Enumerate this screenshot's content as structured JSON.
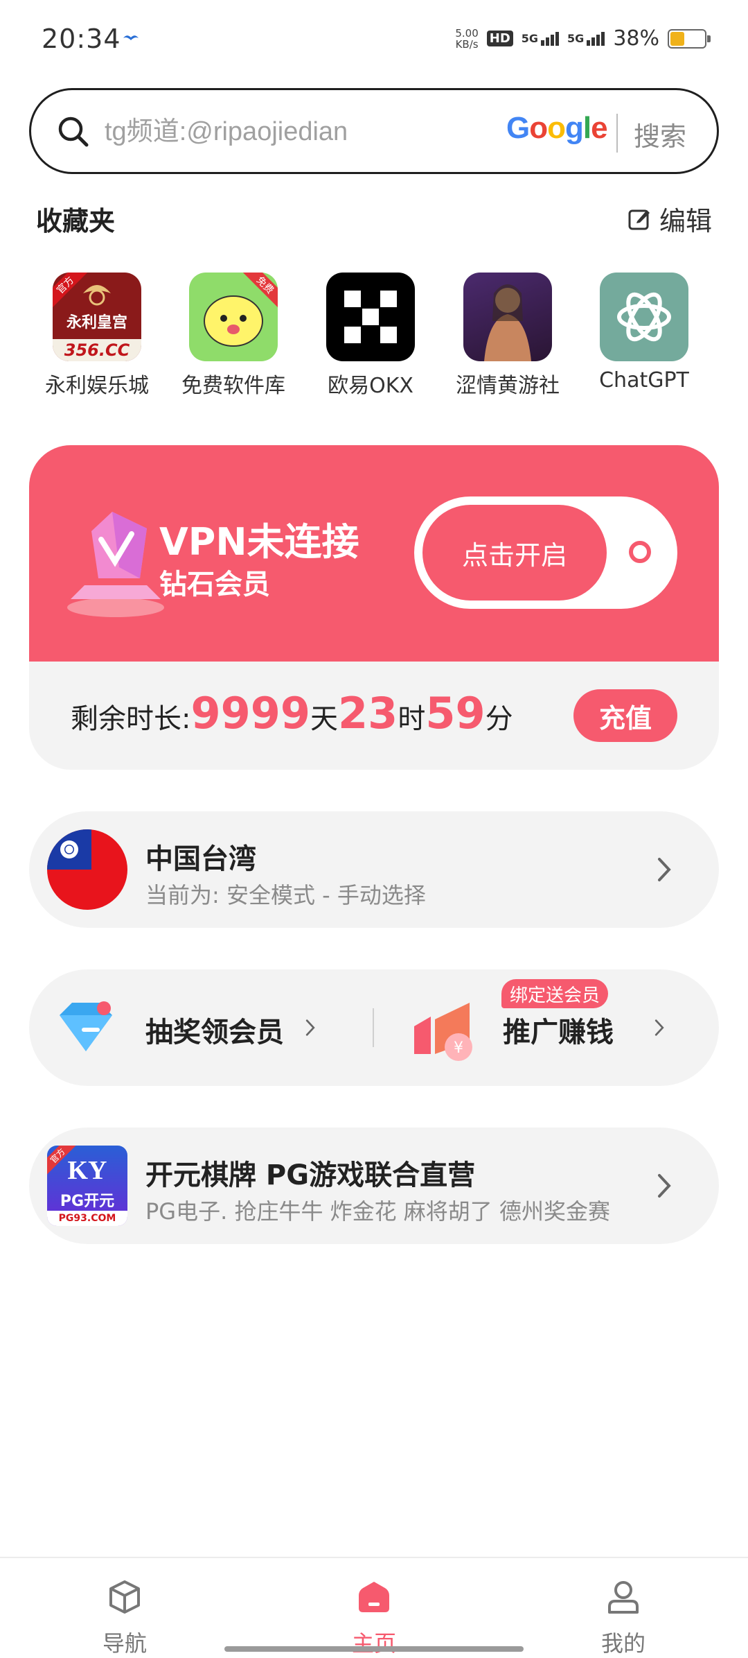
{
  "status_bar": {
    "time": "20:34",
    "net_speed_value": "5.00",
    "net_speed_unit": "KB/s",
    "hd": "HD",
    "signal1": "5G",
    "signal2": "5G",
    "battery": "38%"
  },
  "search": {
    "placeholder": "tg频道:@ripaojiedian",
    "engine": "Google",
    "button": "搜索"
  },
  "favorites": {
    "title": "收藏夹",
    "edit": "编辑",
    "apps": [
      {
        "label": "永利娱乐城",
        "icon": "yongli-casino-icon",
        "icon_text_top": "永利皇宫",
        "icon_text_bottom": "356.CC",
        "badge": "官方"
      },
      {
        "label": "免费软件库",
        "icon": "free-software-icon",
        "badge": "免费"
      },
      {
        "label": "欧易OKX",
        "icon": "okx-icon"
      },
      {
        "label": "涩情黄游社",
        "icon": "game-club-icon"
      },
      {
        "label": "ChatGPT",
        "icon": "chatgpt-icon"
      }
    ]
  },
  "vpn": {
    "status": "VPN未连接",
    "level": "钻石会员",
    "connect_button": "点击开启",
    "remaining_label": "剩余时长:",
    "days": "9999",
    "days_unit": "天",
    "hours": "23",
    "hours_unit": "时",
    "minutes": "59",
    "minutes_unit": "分",
    "recharge": "充值",
    "accent": "#f65a6e"
  },
  "server": {
    "name": "中国台湾",
    "mode": "当前为: 安全模式 - 手动选择"
  },
  "promo": {
    "lottery": "抽奖领会员",
    "promote": "推广赚钱",
    "badge": "绑定送会员"
  },
  "ad": {
    "title": "开元棋牌 PG游戏联合直营",
    "desc": "PG电子. 抢庄牛牛 炸金花  麻将胡了 德州奖金赛",
    "icon_badge": "官方",
    "icon_brand": "KY",
    "icon_name": "PG开元",
    "icon_url": "PG93.COM"
  },
  "nav": {
    "items": [
      {
        "label": "导航",
        "icon": "cube-icon"
      },
      {
        "label": "主页",
        "icon": "home-icon"
      },
      {
        "label": "我的",
        "icon": "profile-icon"
      }
    ]
  }
}
